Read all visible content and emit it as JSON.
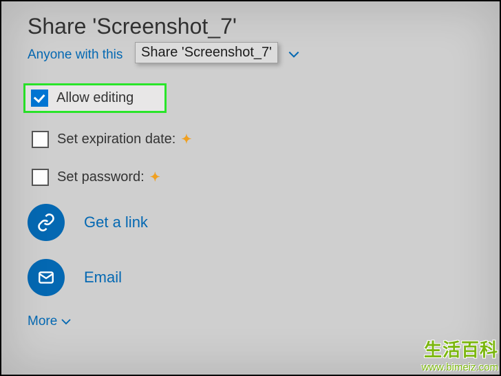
{
  "title": "Share 'Screenshot_7'",
  "linkDescription": "Anyone with this",
  "tooltip": "Share 'Screenshot_7'",
  "options": {
    "allowEditing": {
      "label": "Allow editing",
      "checked": true
    },
    "expiration": {
      "label": "Set expiration date:",
      "checked": false
    },
    "password": {
      "label": "Set password:",
      "checked": false
    }
  },
  "actions": {
    "getLink": "Get a link",
    "email": "Email"
  },
  "more": "More",
  "watermark": {
    "cn": "生活百科",
    "url": "www.bimeiz.com"
  }
}
